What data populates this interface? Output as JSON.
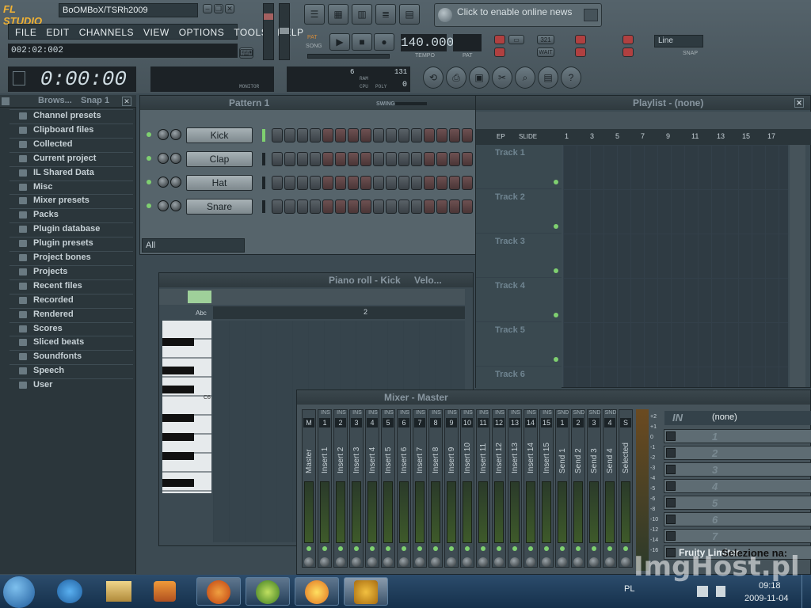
{
  "app": {
    "logo": "FL STUDIO",
    "project_name": "BoOMBoX/TSRh2009"
  },
  "menu": [
    "FILE",
    "EDIT",
    "CHANNELS",
    "VIEW",
    "OPTIONS",
    "TOOLS",
    "HELP"
  ],
  "hint_bar": "002:02:002",
  "time_display": "0:00:00",
  "news": "Click to enable online news",
  "transport": {
    "pat_label": "PAT",
    "song_label": "SONG",
    "tempo": "140.000",
    "tempo_label": "TEMPO",
    "pat_num_label": "PAT"
  },
  "monitor_label": "MONITOR",
  "cpu": {
    "poly_value": "0",
    "cpu_label": "CPU",
    "poly_label": "POLY",
    "ram_label": "RAM",
    "value_6": "6",
    "value_131": "131"
  },
  "snap": {
    "mode": "Line",
    "label": "SNAP"
  },
  "browser": {
    "title": "Brows...",
    "snap": "Snap 1",
    "items": [
      "Channel presets",
      "Clipboard files",
      "Collected",
      "Current project",
      "IL Shared Data",
      "Misc",
      "Mixer presets",
      "Packs",
      "Plugin database",
      "Plugin presets",
      "Project bones",
      "Projects",
      "Recent files",
      "Recorded",
      "Rendered",
      "Scores",
      "Sliced beats",
      "Soundfonts",
      "Speech",
      "User"
    ]
  },
  "step_seq": {
    "title": "Pattern 1",
    "swing": "SWING",
    "channels": [
      "Kick",
      "Clap",
      "Hat",
      "Snare"
    ],
    "filter": "All"
  },
  "playlist": {
    "title": "Playlist - (none)",
    "slide": "SLIDE",
    "step": "EP",
    "ruler": [
      "1",
      "3",
      "5",
      "7",
      "9",
      "11",
      "13",
      "15",
      "17"
    ],
    "tracks": [
      "Track 1",
      "Track 2",
      "Track 3",
      "Track 4",
      "Track 5",
      "Track 6"
    ]
  },
  "piano_roll": {
    "title": "Piano roll - Kick",
    "velo": "Velo...",
    "abc": "Abc",
    "marker": "2",
    "c_label": "C6"
  },
  "mixer": {
    "title": "Mixer - Master",
    "channels": [
      {
        "lab": "Master",
        "ins": "",
        "num": "M"
      },
      {
        "lab": "Insert 1",
        "ins": "INS",
        "num": "1"
      },
      {
        "lab": "Insert 2",
        "ins": "INS",
        "num": "2"
      },
      {
        "lab": "Insert 3",
        "ins": "INS",
        "num": "3"
      },
      {
        "lab": "Insert 4",
        "ins": "INS",
        "num": "4"
      },
      {
        "lab": "Insert 5",
        "ins": "INS",
        "num": "5"
      },
      {
        "lab": "Insert 6",
        "ins": "INS",
        "num": "6"
      },
      {
        "lab": "Insert 7",
        "ins": "INS",
        "num": "7"
      },
      {
        "lab": "Insert 8",
        "ins": "INS",
        "num": "8"
      },
      {
        "lab": "Insert 9",
        "ins": "INS",
        "num": "9"
      },
      {
        "lab": "Insert 10",
        "ins": "INS",
        "num": "10"
      },
      {
        "lab": "Insert 11",
        "ins": "INS",
        "num": "11"
      },
      {
        "lab": "Insert 12",
        "ins": "INS",
        "num": "12"
      },
      {
        "lab": "Insert 13",
        "ins": "INS",
        "num": "13"
      },
      {
        "lab": "Insert 14",
        "ins": "INS",
        "num": "14"
      },
      {
        "lab": "Insert 15",
        "ins": "INS",
        "num": "15"
      },
      {
        "lab": "Send 1",
        "ins": "SND",
        "num": "1"
      },
      {
        "lab": "Send 2",
        "ins": "SND",
        "num": "2"
      },
      {
        "lab": "Send 3",
        "ins": "SND",
        "num": "3"
      },
      {
        "lab": "Send 4",
        "ins": "SND",
        "num": "4"
      },
      {
        "lab": "Selected",
        "ins": "",
        "num": "S"
      }
    ],
    "db_scale": [
      "+2",
      "+1",
      "0",
      "-1",
      "-2",
      "-3",
      "-4",
      "-5",
      "-6",
      "-8",
      "-10",
      "-12",
      "-14",
      "-16"
    ],
    "in_label": "IN",
    "in_value": "(none)",
    "fx_slots": [
      "1",
      "2",
      "3",
      "4",
      "5",
      "6",
      "7"
    ],
    "fx_loaded": "Fruity Limiter",
    "fx_overlay": "Selezione na:"
  },
  "taskbar": {
    "lang": "PL",
    "time": "09:18",
    "date": "2009-11-04"
  },
  "watermark": "ImgHost.pl"
}
